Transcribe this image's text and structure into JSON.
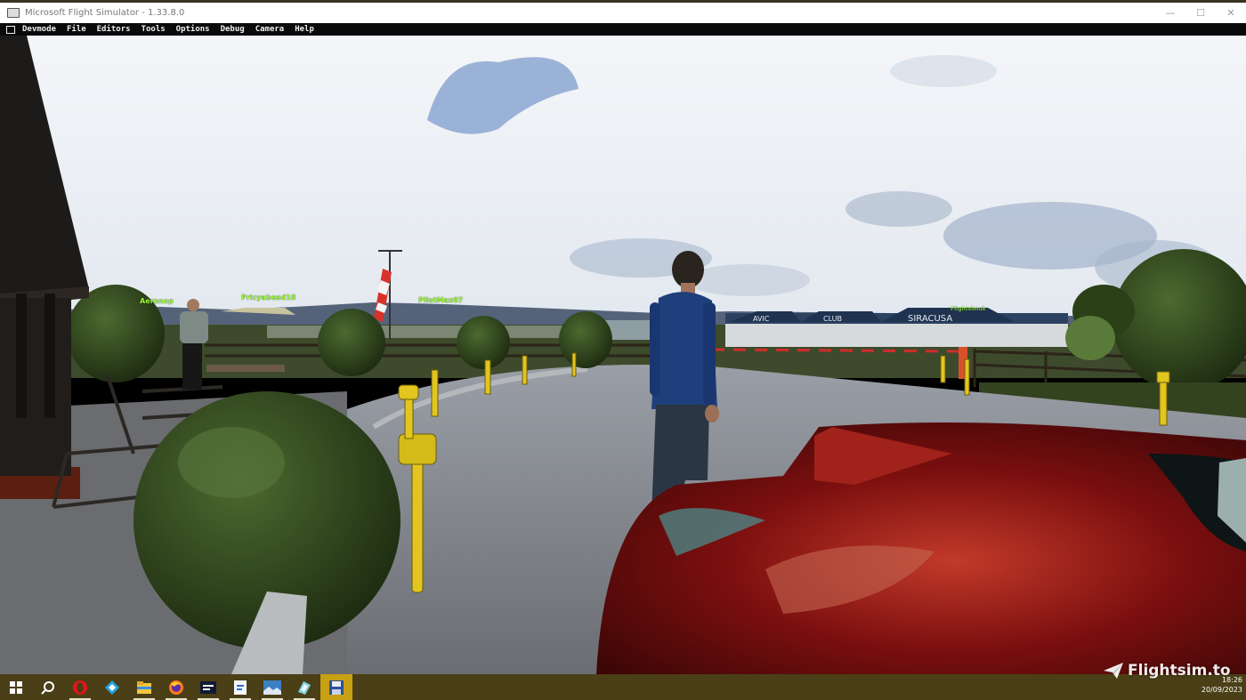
{
  "window": {
    "title": "Microsoft Flight Simulator - 1.33.8.0",
    "controls": [
      "minimize",
      "maximize",
      "close"
    ]
  },
  "menubar": {
    "items": [
      "Devmode",
      "File",
      "Editors",
      "Tools",
      "Options",
      "Debug",
      "Camera",
      "Help"
    ]
  },
  "scene": {
    "player_tags": [
      "Aeronop",
      "Pricyabead10",
      "PilotMax07",
      "Flightsimuk"
    ],
    "hangar_signs": [
      "AVIC",
      "CLUB",
      "SIRACUSA"
    ]
  },
  "taskbar": {
    "icons": [
      "windows-start-icon",
      "search-icon",
      "opera-icon",
      "kodi-icon",
      "file-explorer-icon",
      "firefox-icon",
      "app-icon",
      "notepad-icon",
      "image-viewer-icon",
      "paint-icon",
      "save-icon"
    ],
    "time": "18:26",
    "date": "20/09/2023"
  },
  "watermark": {
    "text": "Flightsim.to"
  },
  "colors": {
    "taskbar": "#4a3f16",
    "tag": "#9dff3a",
    "car": "#8a1010",
    "sky": "#e9eef4"
  }
}
